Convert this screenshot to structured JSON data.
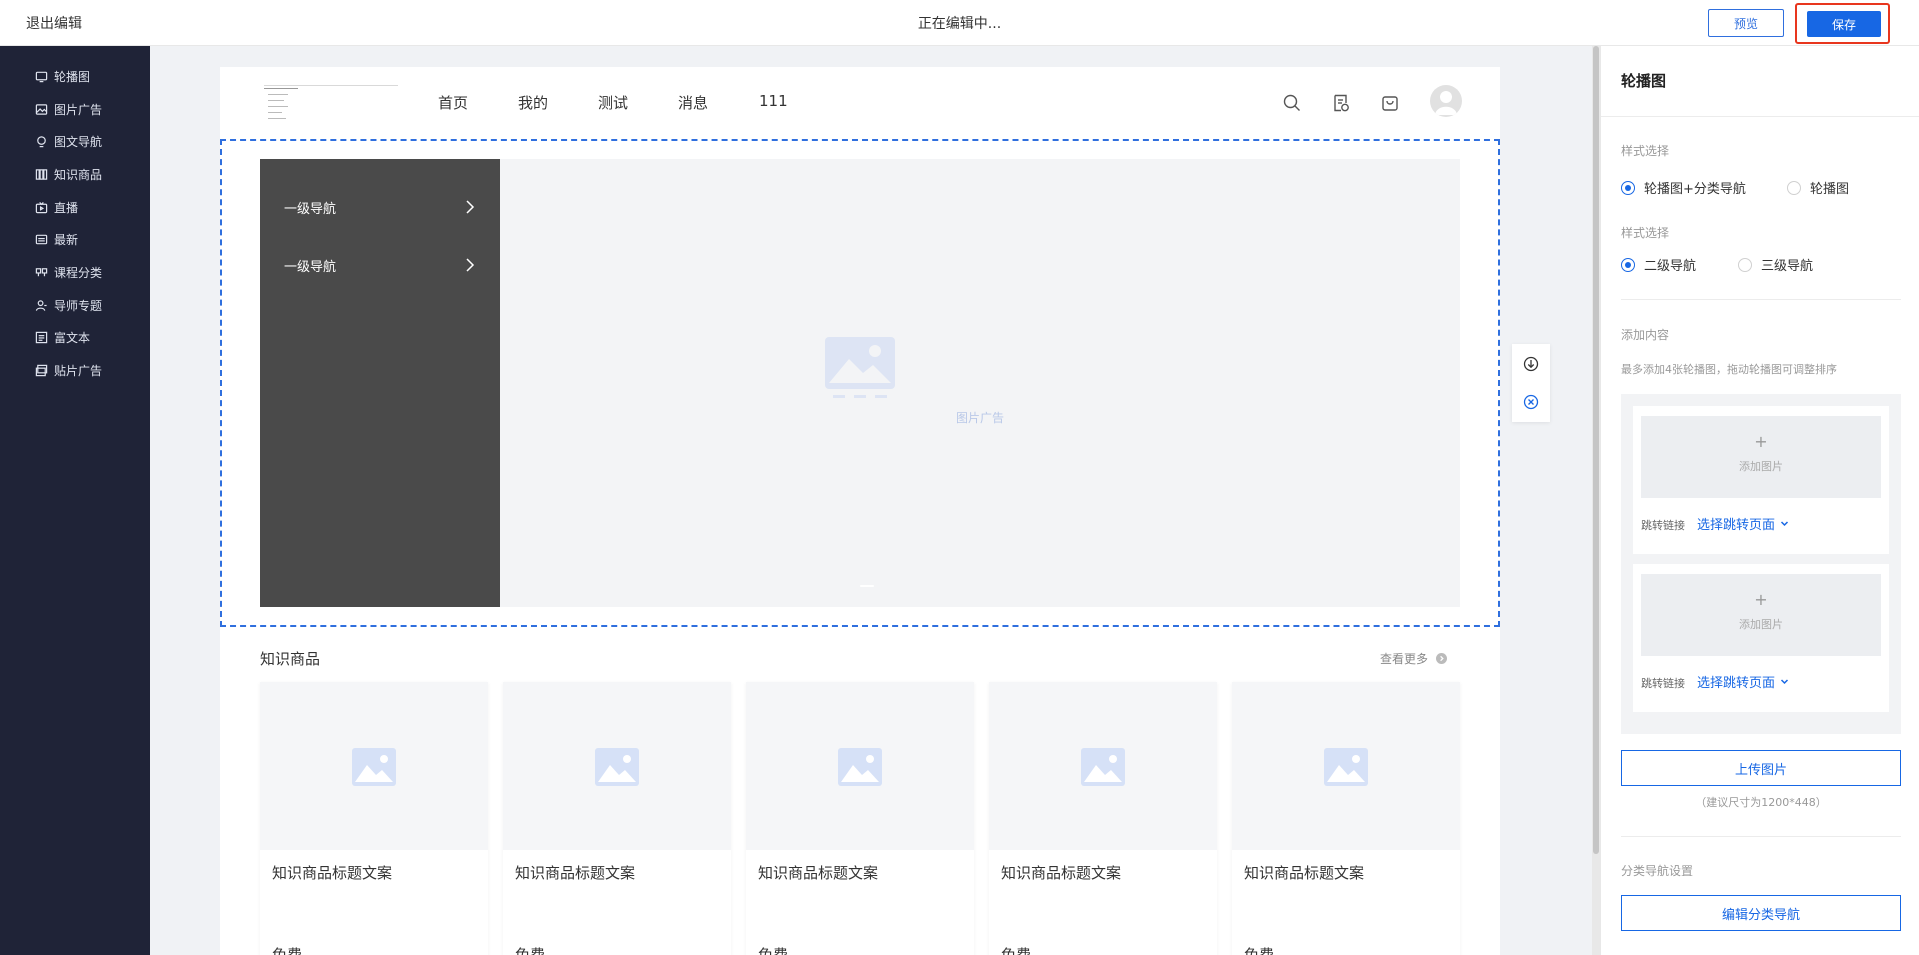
{
  "topbar": {
    "exit_label": "退出编辑",
    "status_text": "正在编辑中...",
    "preview_label": "预览",
    "save_label": "保存"
  },
  "sidebar": {
    "items": [
      {
        "label": "轮播图",
        "icon": "carousel-icon"
      },
      {
        "label": "图片广告",
        "icon": "image-ad-icon"
      },
      {
        "label": "图文导航",
        "icon": "pin-icon"
      },
      {
        "label": "知识商品",
        "icon": "books-icon"
      },
      {
        "label": "直播",
        "icon": "live-icon"
      },
      {
        "label": "最新",
        "icon": "news-icon"
      },
      {
        "label": "课程分类",
        "icon": "category-icon"
      },
      {
        "label": "导师专题",
        "icon": "mentor-icon"
      },
      {
        "label": "富文本",
        "icon": "richtext-icon"
      },
      {
        "label": "贴片广告",
        "icon": "patch-ad-icon"
      }
    ]
  },
  "site": {
    "nav": [
      "首页",
      "我的",
      "测试",
      "消息",
      "111"
    ],
    "header_icons": [
      "search-icon",
      "orders-icon",
      "cart-icon",
      "avatar"
    ]
  },
  "banner": {
    "category_nav": [
      {
        "label": "一级导航"
      },
      {
        "label": "一级导航"
      }
    ],
    "placeholder_label": "图片广告"
  },
  "module_tools": [
    "move-down-icon",
    "delete-icon"
  ],
  "knowledge": {
    "title": "知识商品",
    "more_label": "查看更多",
    "cards": [
      {
        "title": "知识商品标题文案",
        "price": "免费"
      },
      {
        "title": "知识商品标题文案",
        "price": "免费"
      },
      {
        "title": "知识商品标题文案",
        "price": "免费"
      },
      {
        "title": "知识商品标题文案",
        "price": "免费"
      },
      {
        "title": "知识商品标题文案",
        "price": "免费"
      }
    ]
  },
  "panel": {
    "title": "轮播图",
    "style_label_1": "样式选择",
    "style_options_1": [
      {
        "label": "轮播图+分类导航",
        "selected": true
      },
      {
        "label": "轮播图",
        "selected": false
      }
    ],
    "style_label_2": "样式选择",
    "style_options_2": [
      {
        "label": "二级导航",
        "selected": true
      },
      {
        "label": "三级导航",
        "selected": false
      }
    ],
    "content_label": "添加内容",
    "content_hint": "最多添加4张轮播图，拖动轮播图可调整排序",
    "slots": [
      {
        "plus": "+",
        "add_label": "添加图片",
        "link_label": "跳转链接",
        "link_select": "选择跳转页面"
      },
      {
        "plus": "+",
        "add_label": "添加图片",
        "link_label": "跳转链接",
        "link_select": "选择跳转页面"
      }
    ],
    "upload_label": "上传图片",
    "size_tip": "（建议尺寸为1200*448）",
    "catnav_settings_label": "分类导航设置",
    "edit_catnav_label": "编辑分类导航"
  },
  "colors": {
    "accent": "#1767e4",
    "sidebar_bg": "#1f2337",
    "highlight": "#e8361e"
  }
}
